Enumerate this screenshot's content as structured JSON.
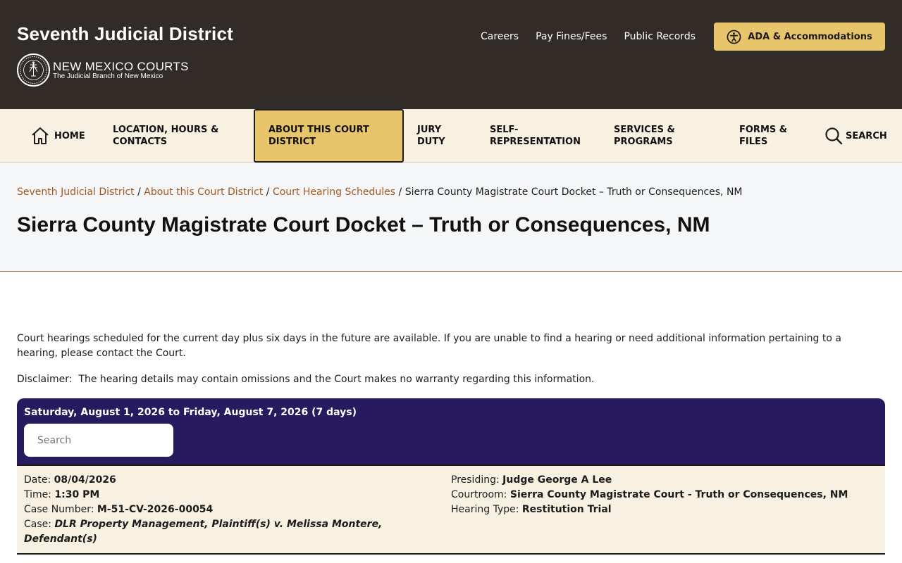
{
  "header": {
    "site_title": "Seventh Judicial District",
    "brand_name": "NEW MEXICO COURTS",
    "brand_sub": "The Judicial Branch of New Mexico",
    "util_links": [
      "Careers",
      "Pay Fines/Fees",
      "Public Records"
    ],
    "ada_label": "ADA & Accommodations"
  },
  "nav": {
    "home": "HOME",
    "location": "LOCATION, HOURS & CONTACTS",
    "about": "ABOUT THIS COURT DISTRICT",
    "jury": "JURY DUTY",
    "self_rep": "SELF-REPRESENTATION",
    "services": "SERVICES & PROGRAMS",
    "forms": "FORMS & FILES",
    "search": "SEARCH"
  },
  "breadcrumb": {
    "items": [
      "Seventh Judicial District",
      "About this Court District",
      "Court Hearing Schedules"
    ],
    "current": "Sierra County Magistrate Court Docket – Truth or Consequences, NM",
    "sep": " / "
  },
  "page_title": "Sierra County Magistrate Court Docket – Truth or Consequences, NM",
  "intro": "Court hearings scheduled for the current day plus six days in the future are available. If you are unable to find a hearing or need additional information pertaining to a hearing, please contact the Court.",
  "disclaimer": "Disclaimer:  The hearing details may contain omissions and the Court makes no warranty regarding this information.",
  "docket": {
    "range": "Saturday, August 1, 2026 to Friday, August 7, 2026 (7 days)",
    "search_placeholder": "Search",
    "hearings": [
      {
        "date_label": "Date:",
        "date": "08/04/2026",
        "time_label": "Time:",
        "time": "1:30 PM",
        "case_number_label": "Case Number:",
        "case_number": "M-51-CV-2026-00054",
        "case_label": "Case:",
        "case": "DLR Property Management, Plaintiff(s) v. Melissa Montere, Defendant(s)",
        "presiding_label": "Presiding:",
        "presiding": "Judge George A Lee",
        "courtroom_label": "Courtroom:",
        "courtroom": "Sierra County Magistrate Court - Truth or Consequences, NM",
        "hearing_type_label": "Hearing Type:",
        "hearing_type": "Restitution Trial"
      }
    ]
  },
  "colors": {
    "header_bg": "#322c29",
    "accent_gold": "#e8c56b",
    "nav_bg": "#f8f1e1",
    "docket_header": "#271a5e",
    "link": "#a5561f"
  }
}
